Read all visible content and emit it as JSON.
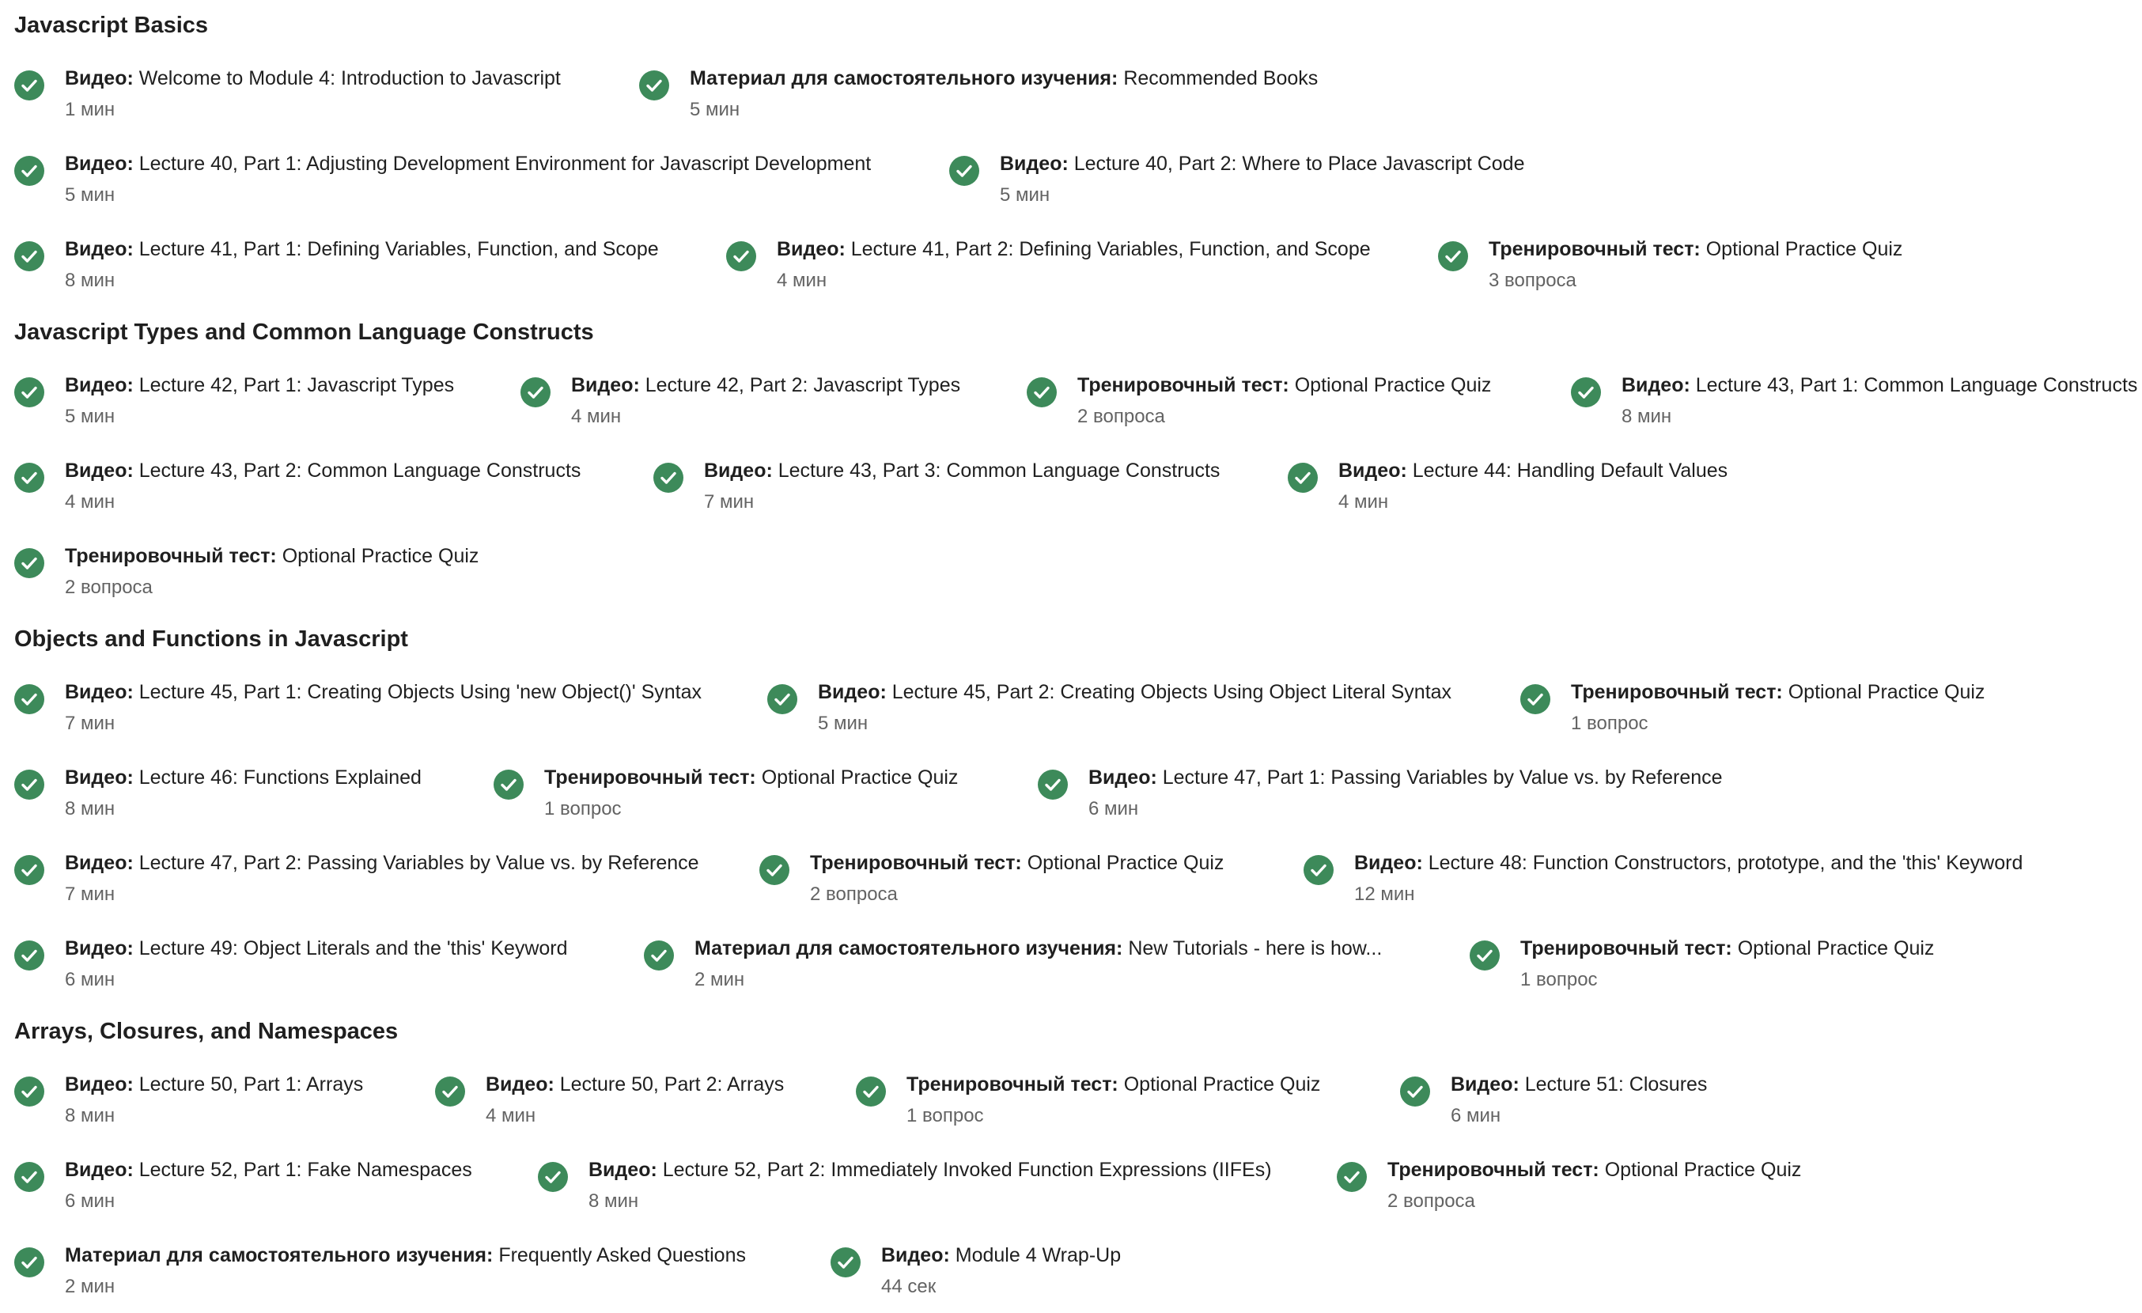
{
  "theme": {
    "check_color": "#3d8a5a",
    "check_icon": "check-circle-icon"
  },
  "sections": [
    {
      "title": "Javascript Basics",
      "items": [
        {
          "type": "Видео:",
          "title": "Welcome to Module 4: Introduction to Javascript",
          "meta": "1 мин"
        },
        {
          "type": "Материал для самостоятельного изучения:",
          "title": "Recommended Books",
          "meta": "5 мин"
        },
        {
          "type": "Видео:",
          "title": "Lecture 40, Part 1: Adjusting Development Environment for Javascript Development",
          "meta": "5 мин"
        },
        {
          "type": "Видео:",
          "title": "Lecture 40, Part 2: Where to Place Javascript Code",
          "meta": "5 мин"
        },
        {
          "type": "Видео:",
          "title": "Lecture 41, Part 1: Defining Variables, Function, and Scope",
          "meta": "8 мин"
        },
        {
          "type": "Видео:",
          "title": "Lecture 41, Part 2: Defining Variables, Function, and Scope",
          "meta": "4 мин"
        },
        {
          "type": "Тренировочный тест:",
          "title": "Optional Practice Quiz",
          "meta": "3 вопроса"
        }
      ]
    },
    {
      "title": "Javascript Types and Common Language Constructs",
      "items": [
        {
          "type": "Видео:",
          "title": "Lecture 42, Part 1: Javascript Types",
          "meta": "5 мин"
        },
        {
          "type": "Видео:",
          "title": "Lecture 42, Part 2: Javascript Types",
          "meta": "4 мин"
        },
        {
          "type": "Тренировочный тест:",
          "title": "Optional Practice Quiz",
          "meta": "2 вопроса"
        },
        {
          "type": "Видео:",
          "title": "Lecture 43, Part 1: Common Language Constructs",
          "meta": "8 мин"
        },
        {
          "type": "Видео:",
          "title": "Lecture 43, Part 2: Common Language Constructs",
          "meta": "4 мин"
        },
        {
          "type": "Видео:",
          "title": "Lecture 43, Part 3: Common Language Constructs",
          "meta": "7 мин"
        },
        {
          "type": "Видео:",
          "title": "Lecture 44: Handling Default Values",
          "meta": "4 мин"
        },
        {
          "type": "Тренировочный тест:",
          "title": "Optional Practice Quiz",
          "meta": "2 вопроса"
        }
      ]
    },
    {
      "title": "Objects and Functions in Javascript",
      "items": [
        {
          "type": "Видео:",
          "title": "Lecture 45, Part 1: Creating Objects Using 'new Object()' Syntax",
          "meta": "7 мин"
        },
        {
          "type": "Видео:",
          "title": "Lecture 45, Part 2: Creating Objects Using Object Literal Syntax",
          "meta": "5 мин"
        },
        {
          "type": "Тренировочный тест:",
          "title": "Optional Practice Quiz",
          "meta": "1 вопрос"
        },
        {
          "type": "Видео:",
          "title": "Lecture 46: Functions Explained",
          "meta": "8 мин"
        },
        {
          "type": "Тренировочный тест:",
          "title": "Optional Practice Quiz",
          "meta": "1 вопрос"
        },
        {
          "type": "Видео:",
          "title": "Lecture 47, Part 1: Passing Variables by Value vs. by Reference",
          "meta": "6 мин"
        },
        {
          "type": "Видео:",
          "title": "Lecture 47, Part 2: Passing Variables by Value vs. by Reference",
          "meta": "7 мин"
        },
        {
          "type": "Тренировочный тест:",
          "title": "Optional Practice Quiz",
          "meta": "2 вопроса"
        },
        {
          "type": "Видео:",
          "title": "Lecture 48: Function Constructors, prototype, and the 'this' Keyword",
          "meta": "12 мин"
        },
        {
          "type": "Видео:",
          "title": "Lecture 49: Object Literals and the 'this' Keyword",
          "meta": "6 мин"
        },
        {
          "type": "Материал для самостоятельного изучения:",
          "title": "New Tutorials - here is how...",
          "meta": "2 мин"
        },
        {
          "type": "Тренировочный тест:",
          "title": "Optional Practice Quiz",
          "meta": "1 вопрос"
        }
      ]
    },
    {
      "title": "Arrays, Closures, and Namespaces",
      "items": [
        {
          "type": "Видео:",
          "title": "Lecture 50, Part 1: Arrays",
          "meta": "8 мин"
        },
        {
          "type": "Видео:",
          "title": "Lecture 50, Part 2: Arrays",
          "meta": "4 мин"
        },
        {
          "type": "Тренировочный тест:",
          "title": "Optional Practice Quiz",
          "meta": "1 вопрос"
        },
        {
          "type": "Видео:",
          "title": "Lecture 51: Closures",
          "meta": "6 мин"
        },
        {
          "type": "Видео:",
          "title": "Lecture 52, Part 1: Fake Namespaces",
          "meta": "6 мин"
        },
        {
          "type": "Видео:",
          "title": "Lecture 52, Part 2: Immediately Invoked Function Expressions (IIFEs)",
          "meta": "8 мин"
        },
        {
          "type": "Тренировочный тест:",
          "title": "Optional Practice Quiz",
          "meta": "2 вопроса"
        },
        {
          "type": "Материал для самостоятельного изучения:",
          "title": "Frequently Asked Questions",
          "meta": "2 мин"
        },
        {
          "type": "Видео:",
          "title": "Module 4 Wrap-Up",
          "meta": "44 сек"
        }
      ]
    }
  ]
}
